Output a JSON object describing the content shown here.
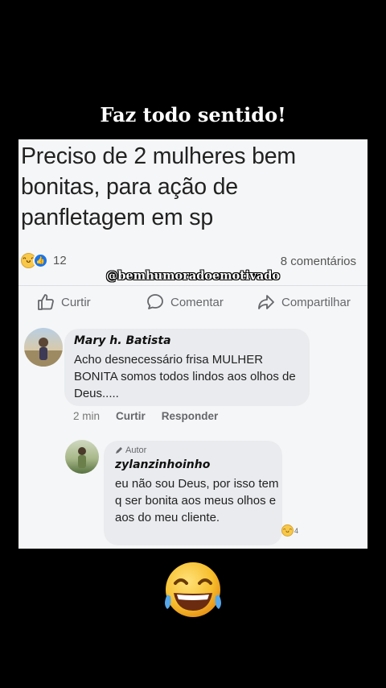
{
  "headline": "Faz todo sentido!",
  "post": {
    "text": "Preciso de 2 mulheres bem bonitas, para ação de panfletagem em sp",
    "reaction_count": "12",
    "comments_count": "8 comentários"
  },
  "watermark": "@bemhumoradoemotivado",
  "actions": {
    "like": "Curtir",
    "comment": "Comentar",
    "share": "Compartilhar"
  },
  "comment1": {
    "author": "Mary h. Batista",
    "text": "Acho desnecessário frisa MULHER BONITA somos todos lindos aos olhos de Deus.....",
    "time": "2 min",
    "like": "Curtir",
    "reply": "Responder"
  },
  "comment2": {
    "badge": "Autor",
    "author": "zylanzinhoinho",
    "text": "eu não sou Deus, por isso tem q ser bonita aos meus olhos e aos do meu cliente.",
    "reaction_count": "4"
  },
  "icons": {
    "like": "thumbs-up-icon",
    "comment": "comment-bubble-icon",
    "share": "share-arrow-icon",
    "reaction": "laughing-tears-emoji"
  }
}
